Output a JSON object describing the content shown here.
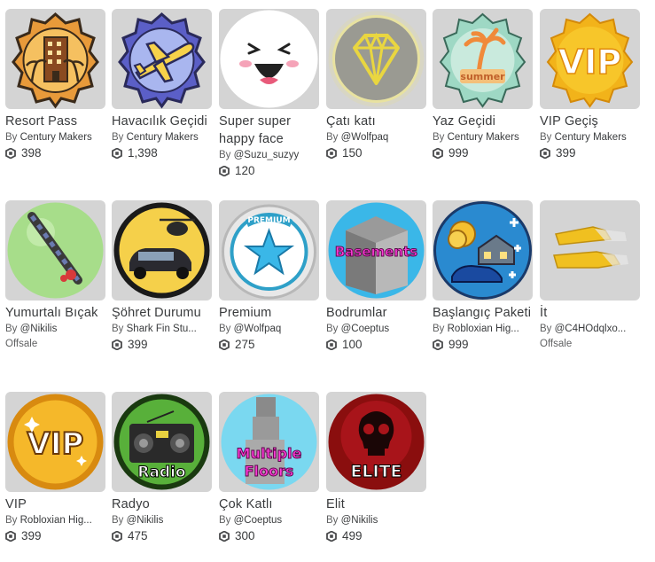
{
  "items": [
    {
      "name": "Resort Pass",
      "by": "By",
      "creator": "Century Makers",
      "price": "398",
      "icon": "resort-building-icon"
    },
    {
      "name": "Havacılık Geçidi",
      "by": "By",
      "creator": "Century Makers",
      "price": "1,398",
      "icon": "airplane-badge-icon"
    },
    {
      "name": "Super super happy face",
      "by": "By",
      "creator": "@Suzu_suzyy",
      "price": "120",
      "icon": "happy-face-icon"
    },
    {
      "name": "Çatı katı",
      "by": "By",
      "creator": "@Wolfpaq",
      "price": "150",
      "icon": "diamond-icon"
    },
    {
      "name": "Yaz Geçidi",
      "by": "By",
      "creator": "Century Makers",
      "price": "999",
      "icon": "summer-palm-icon",
      "badge_text": "summer"
    },
    {
      "name": "VIP Geçiş",
      "by": "By",
      "creator": "Century Makers",
      "price": "399",
      "icon": "vip-gold-badge-icon",
      "badge_text": "VIP"
    },
    {
      "name": "Yumurtalı Bıçak",
      "by": "By",
      "creator": "@Nikilis",
      "offsale": "Offsale",
      "icon": "egg-knife-icon"
    },
    {
      "name": "Şöhret Durumu",
      "by": "By",
      "creator": "Shark Fin Stu...",
      "price": "399",
      "icon": "helicopter-car-icon"
    },
    {
      "name": "Premium",
      "by": "By",
      "creator": "@Wolfpaq",
      "price": "275",
      "icon": "premium-star-icon",
      "badge_text": "PREMIUM"
    },
    {
      "name": "Bodrumlar",
      "by": "By",
      "creator": "@Coeptus",
      "price": "100",
      "icon": "basement-icon",
      "badge_text": "Basements"
    },
    {
      "name": "Başlangıç Paketi",
      "by": "By",
      "creator": "Robloxian Hig...",
      "price": "999",
      "icon": "starter-pack-icon"
    },
    {
      "name": "İt",
      "by": "By",
      "creator": "@C4HOdqlxo...",
      "offsale": "Offsale",
      "icon": "gold-dog-icon"
    },
    {
      "name": "VIP",
      "by": "By",
      "creator": "Robloxian Hig...",
      "price": "399",
      "icon": "vip-circle-icon",
      "badge_text": "VIP"
    },
    {
      "name": "Radyo",
      "by": "By",
      "creator": "@Nikilis",
      "price": "475",
      "icon": "radio-icon",
      "badge_text": "Radio"
    },
    {
      "name": "Çok Katlı",
      "by": "By",
      "creator": "@Coeptus",
      "price": "300",
      "icon": "multiple-floors-icon",
      "badge_text": "Multiple Floors"
    },
    {
      "name": "Elit",
      "by": "By",
      "creator": "@Nikilis",
      "price": "499",
      "icon": "elite-skull-icon",
      "badge_text": "ELITE"
    }
  ],
  "colors": {
    "thumb_bg": "#d4d4d4",
    "text": "#393b3d",
    "muted": "#606162"
  }
}
